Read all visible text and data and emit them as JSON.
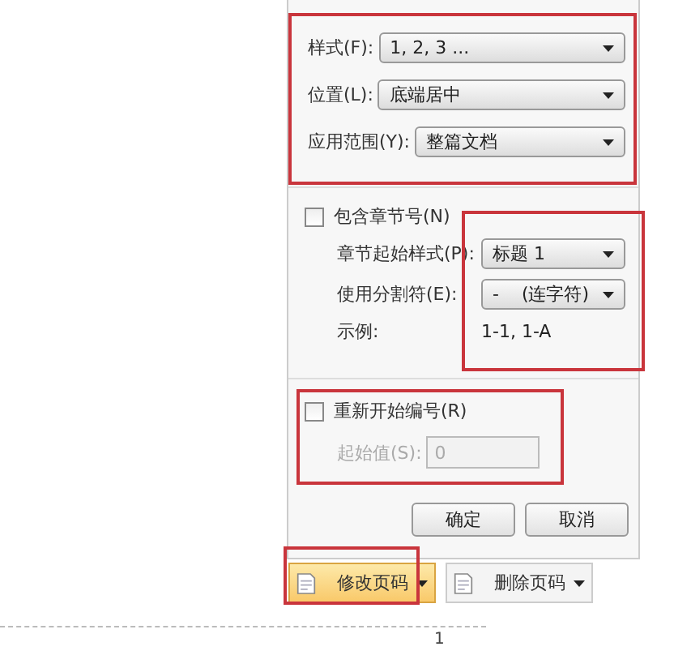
{
  "dialog": {
    "fields": [
      {
        "label": "样式(F):",
        "value": "1, 2, 3 ..."
      },
      {
        "label": "位置(L):",
        "value": "底端居中"
      },
      {
        "label": "应用范围(Y):",
        "value": "整篇文档"
      }
    ],
    "include_chapter": {
      "label": "包含章节号(N)",
      "checked": false
    },
    "chapter_fields": [
      {
        "label": "章节起始样式(P):",
        "value": "标题 1"
      },
      {
        "label": "使用分割符(E):",
        "value": "-    (连字符)"
      }
    ],
    "example": {
      "label": "示例:",
      "value": "1-1, 1-A"
    },
    "restart": {
      "label": "重新开始编号(R)",
      "checked": false
    },
    "start_value": {
      "label": "起始值(S):",
      "value": "0",
      "disabled": true
    },
    "buttons": [
      "确定",
      "取消"
    ]
  },
  "toolbar": [
    {
      "label": "修改页码",
      "selected": true
    },
    {
      "label": "删除页码",
      "selected": false
    }
  ],
  "footer": {
    "page_number": "1"
  }
}
